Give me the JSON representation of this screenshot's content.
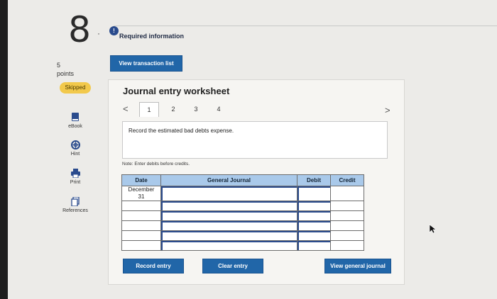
{
  "question": {
    "number": "8",
    "points_value": "5",
    "points_label": "points",
    "status": "Skipped"
  },
  "sidebar": {
    "tools": [
      {
        "label": "eBook",
        "icon": "book-icon"
      },
      {
        "label": "Hint",
        "icon": "lifebuoy-icon"
      },
      {
        "label": "Print",
        "icon": "printer-icon"
      },
      {
        "label": "References",
        "icon": "documents-icon"
      }
    ]
  },
  "required": {
    "badge": "!",
    "label": "Required information"
  },
  "buttons": {
    "view_transaction_list": "View transaction list",
    "record_entry": "Record entry",
    "clear_entry": "Clear entry",
    "view_general_journal": "View general journal"
  },
  "worksheet": {
    "title": "Journal entry worksheet",
    "tabs": [
      "1",
      "2",
      "3",
      "4"
    ],
    "active_tab": "1",
    "prev_glyph": "<",
    "next_glyph": ">",
    "instruction": "Record the estimated bad debts expense.",
    "note": "Note: Enter debits before credits."
  },
  "journal": {
    "headers": {
      "date": "Date",
      "general_journal": "General Journal",
      "debit": "Debit",
      "credit": "Credit"
    },
    "first_row_date_line1": "December",
    "first_row_date_line2": "31",
    "row_count": 6
  },
  "colors": {
    "accent": "#2166a8",
    "header_fill": "#a9c9ea",
    "skipped_badge": "#f2c94c"
  }
}
